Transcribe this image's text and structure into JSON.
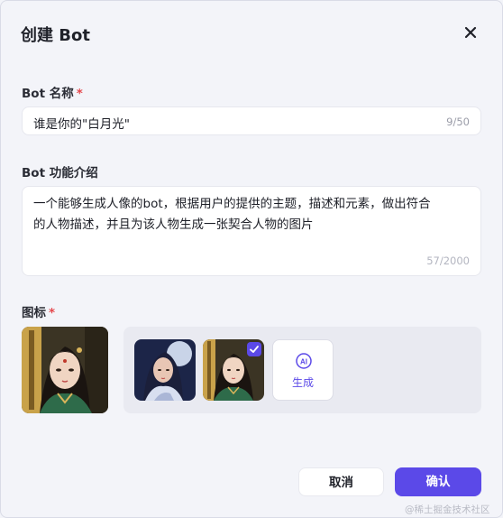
{
  "dialog": {
    "title": "创建 Bot",
    "close_icon": "close-icon"
  },
  "name_field": {
    "label": "Bot 名称",
    "required_mark": "*",
    "value": "谁是你的\"白月光\"",
    "count": "9/50"
  },
  "description_field": {
    "label": "Bot 功能介绍",
    "value": "一个能够生成人像的bot，根据用户的提供的主题，描述和元素，做出符合的人物描述，并且为该人物生成一张契合人物的图片",
    "count": "57/2000"
  },
  "icon_section": {
    "label": "图标",
    "required_mark": "*",
    "generate_label": "生成",
    "generate_icon": "ai-sparkle-icon",
    "selected_index": 1
  },
  "footer": {
    "cancel_label": "取消",
    "confirm_label": "确认"
  },
  "watermark": "@稀土掘金技术社区",
  "colors": {
    "accent": "#5b49e8",
    "required": "#e5484d"
  }
}
